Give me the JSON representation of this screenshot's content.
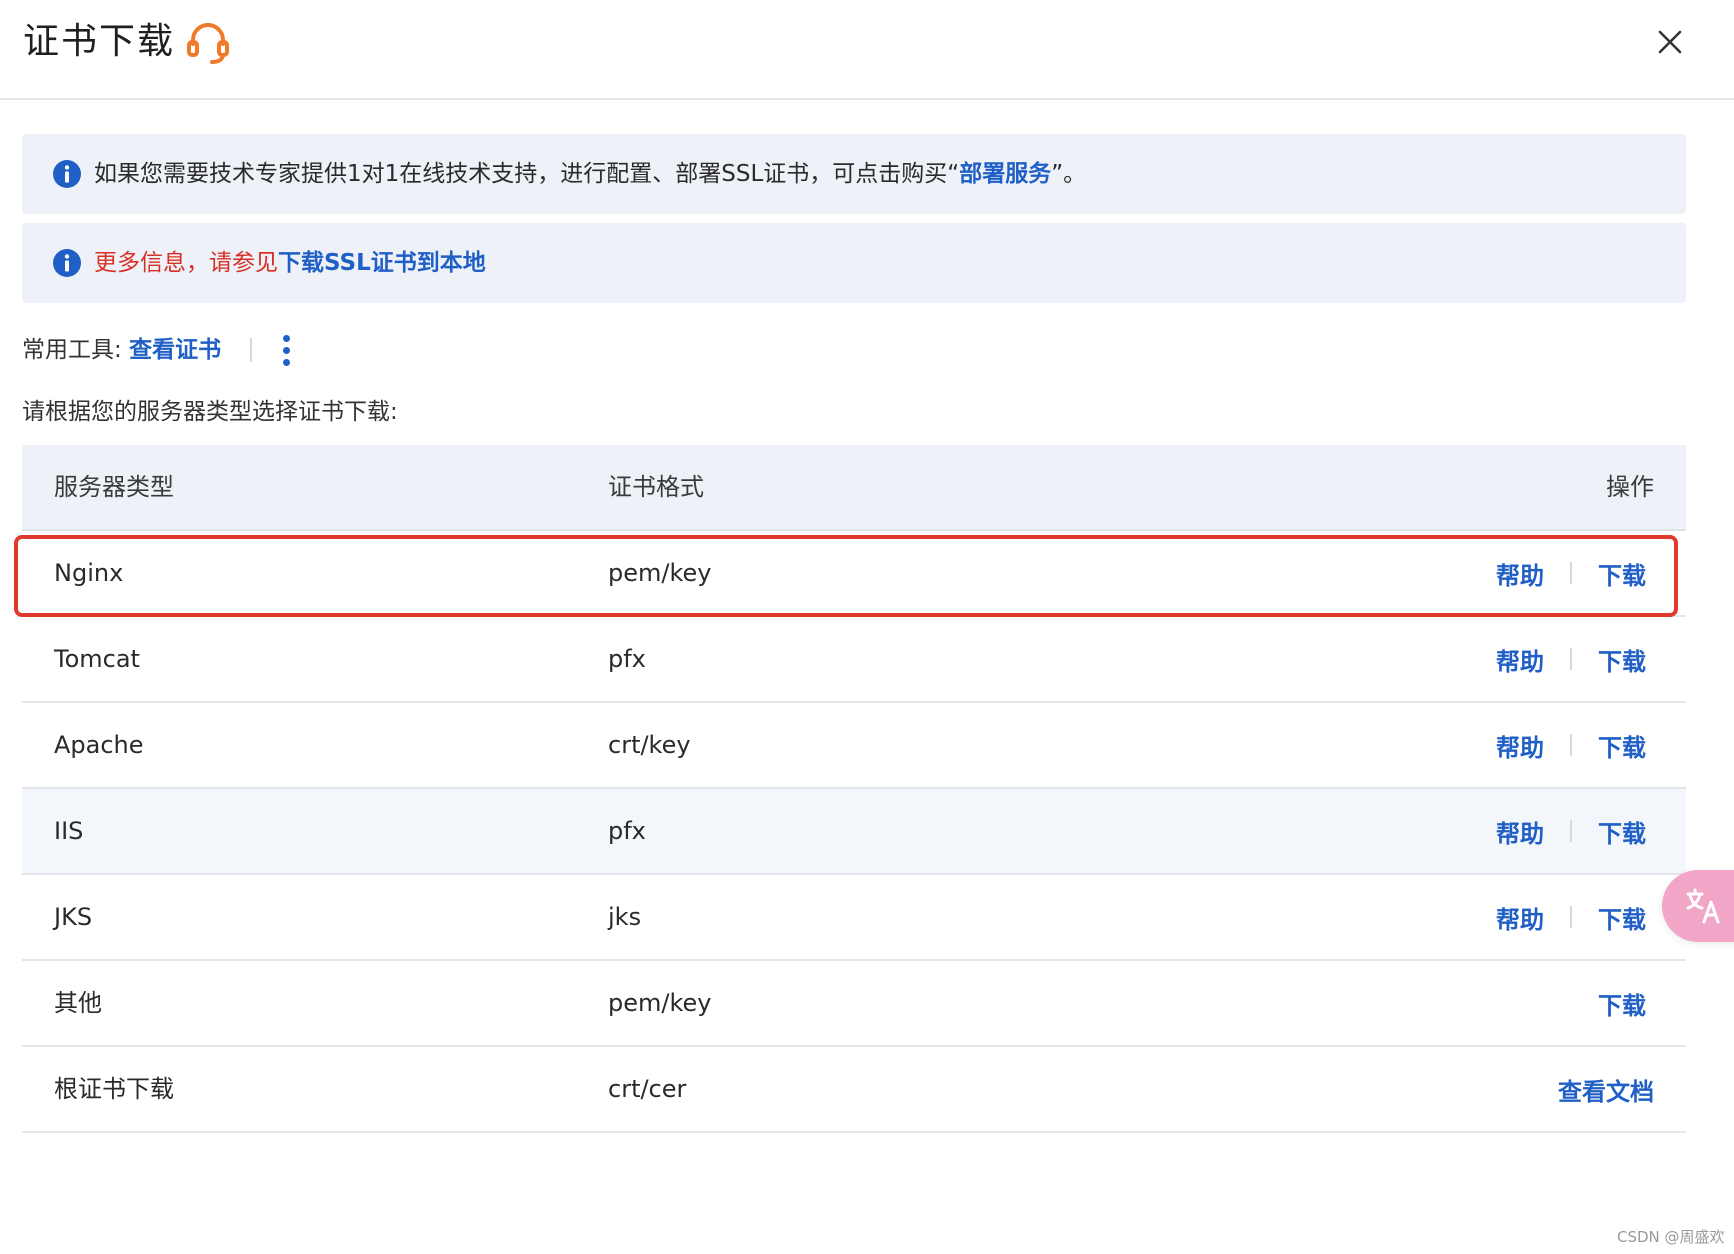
{
  "dialog": {
    "title": "证书下载",
    "close_icon": "close-icon",
    "support_icon": "headset-icon"
  },
  "alerts": {
    "deploy": {
      "text_before": "如果您需要技术专家提供1对1在线技术支持，进行配置、部署SSL证书，可点击购买“",
      "link": "部署服务",
      "text_after": "”。"
    },
    "more_info": {
      "prefix": "更多信息，请参见",
      "link": "下载SSL证书到本地"
    }
  },
  "tools": {
    "label": "常用工具:",
    "view_cert": "查看证书"
  },
  "instruction": "请根据您的服务器类型选择证书下载:",
  "table": {
    "headers": {
      "server_type": "服务器类型",
      "cert_format": "证书格式",
      "action": "操作"
    },
    "rows": [
      {
        "server": "Nginx",
        "format": "pem/key",
        "help": "帮助",
        "download": "下载"
      },
      {
        "server": "Tomcat",
        "format": "pfx",
        "help": "帮助",
        "download": "下载"
      },
      {
        "server": "Apache",
        "format": "crt/key",
        "help": "帮助",
        "download": "下载"
      },
      {
        "server": "IIS",
        "format": "pfx",
        "help": "帮助",
        "download": "下载"
      },
      {
        "server": "JKS",
        "format": "jks",
        "help": "帮助",
        "download": "下载"
      },
      {
        "server": "其他",
        "format": "pem/key",
        "download": "下载"
      },
      {
        "server": "根证书下载",
        "format": "crt/cer",
        "view_doc": "查看文档"
      }
    ]
  },
  "colors": {
    "link": "#1f5fc6",
    "highlight_border": "#e03a2b",
    "alert_bg": "#eef2f8",
    "support_icon": "#f07a2a",
    "translate_button": "#f2a6c7"
  },
  "watermark": "CSDN @周盛欢"
}
